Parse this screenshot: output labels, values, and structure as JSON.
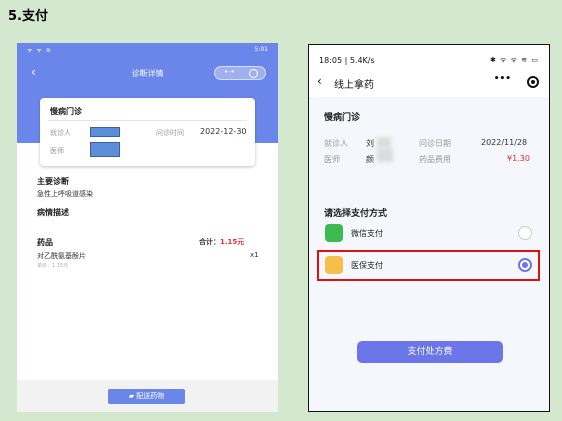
{
  "step_title": "5.支付",
  "left_phone": {
    "status_left": "ᯤ ᯤ ≋",
    "status_right": "5:01",
    "nav_title": "诊断详情",
    "card_title": "慢病门诊",
    "patient_label": "就诊人",
    "visit_time_label": "问诊时间",
    "visit_time_value": "2022-12-30",
    "doctor_label": "医师",
    "diagnosis_title": "主要诊断",
    "diagnosis_value": "急性上呼吸道感染",
    "condition_title": "病情描述",
    "drug_title": "药品",
    "total_label": "合计：",
    "total_value": "1.15元",
    "drug_name": "对乙酰氨基酚片",
    "drug_qty": "x1",
    "unit_price": "单价：1.15元",
    "deliver_button": "配送药物"
  },
  "right_phone": {
    "status_time": "18:05 | 5.4K/s",
    "status_icons": "✱ ᯤ ᯤ ≋ ▭",
    "nav_title": "线上拿药",
    "more_icon": "•••",
    "clinic_title": "慢病门诊",
    "patient_label": "就诊人",
    "patient_value": "刘",
    "visit_date_label": "问诊日期",
    "visit_date_value": "2022/11/28",
    "doctor_label": "医师",
    "doctor_value": "颜",
    "drug_fee_label": "药品费用",
    "drug_fee_value": "¥1.30",
    "pay_method_title": "请选择支付方式",
    "wechat_pay": "微信支付",
    "medical_insurance_pay": "医保支付",
    "pay_button": "支付处方费"
  },
  "colors": {
    "page_bg": "#d3e8ce",
    "primary": "#6b86ea",
    "button": "#6b77e8",
    "price_red": "#e03030",
    "highlight_red": "#e01010",
    "wechat_green": "#3dbb52",
    "insurance_orange": "#f5c04a"
  }
}
